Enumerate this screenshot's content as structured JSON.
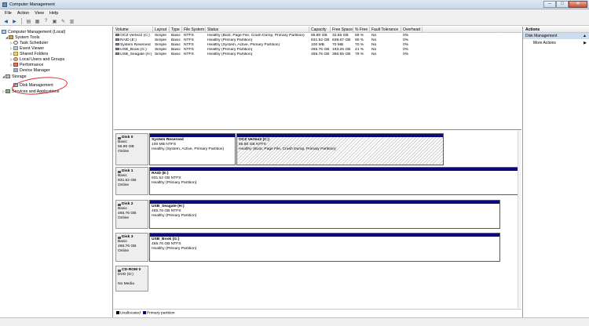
{
  "window": {
    "title": "Computer Management",
    "buttons": {
      "minimize": "─",
      "maximize": "□",
      "close": "✕"
    }
  },
  "menu": [
    "File",
    "Action",
    "View",
    "Help"
  ],
  "toolbar": [
    "back-icon",
    "forward-icon",
    "up-icon",
    "properties-icon",
    "help-icon",
    "refresh-icon",
    "settings-icon",
    "view-icon"
  ],
  "tree": {
    "root": "Computer Management (Local)",
    "system_tools": "System Tools",
    "task_scheduler": "Task Scheduler",
    "event_viewer": "Event Viewer",
    "shared_folders": "Shared Folders",
    "local_users": "Local Users and Groups",
    "performance": "Performance",
    "device_manager": "Device Manager",
    "storage": "Storage",
    "disk_management": "Disk Management",
    "services": "Services and Applications"
  },
  "volume_table": {
    "columns": [
      "Volume",
      "Layout",
      "Type",
      "File System",
      "Status",
      "Capacity",
      "Free Space",
      "% Free",
      "Fault Tolerance",
      "Overhead"
    ],
    "rows": [
      [
        "OCZ Vertex2 (C:)",
        "Simple",
        "Basic",
        "NTFS",
        "Healthy (Boot, Page File, Crash Dump, Primary Partition)",
        "55.80 GB",
        "32.65 GB",
        "59 %",
        "No",
        "0%"
      ],
      [
        "RAID (E:)",
        "Simple",
        "Basic",
        "NTFS",
        "Healthy (Primary Partition)",
        "931.52 GB",
        "839.67 GB",
        "90 %",
        "No",
        "0%"
      ],
      [
        "System Reserved",
        "Simple",
        "Basic",
        "NTFS",
        "Healthy (System, Active, Primary Partition)",
        "100 MB",
        "70 MB",
        "70 %",
        "No",
        "0%"
      ],
      [
        "USB_Book (G:)",
        "Simple",
        "Basic",
        "NTFS",
        "Healthy (Primary Partition)",
        "465.76 GB",
        "193.26 GB",
        "41 %",
        "No",
        "0%"
      ],
      [
        "USB_Seagate (H:)",
        "Simple",
        "Basic",
        "NTFS",
        "Healthy (Primary Partition)",
        "465.76 GB",
        "366.55 GB",
        "79 %",
        "No",
        "0%"
      ]
    ]
  },
  "disks": [
    {
      "name": "Disk 0",
      "type": "Basic",
      "size": "55.90 GB",
      "status": "Online",
      "partitions": [
        {
          "name": "System Reserved",
          "size": "100 MB NTFS",
          "status": "Healthy (System, Active, Primary Partition)"
        },
        {
          "name": "OCZ Vertex2 (C:)",
          "size": "55.80 GB NTFS",
          "status": "Healthy (Boot, Page File, Crash Dump, Primary Partition)"
        }
      ]
    },
    {
      "name": "Disk 1",
      "type": "Basic",
      "size": "931.52 GB",
      "status": "Online",
      "partitions": [
        {
          "name": "RAID (E:)",
          "size": "931.52 GB NTFS",
          "status": "Healthy (Primary Partition)"
        }
      ]
    },
    {
      "name": "Disk 2",
      "type": "Basic",
      "size": "465.76 GB",
      "status": "Online",
      "partitions": [
        {
          "name": "USB_Seagate (H:)",
          "size": "465.76 GB NTFS",
          "status": "Healthy (Primary Partition)"
        }
      ]
    },
    {
      "name": "Disk 3",
      "type": "Basic",
      "size": "465.76 GB",
      "status": "Online",
      "partitions": [
        {
          "name": "USB_Book (G:)",
          "size": "465.76 GB NTFS",
          "status": "Healthy (Primary Partition)"
        }
      ]
    },
    {
      "name": "CD-ROM 0",
      "type": "DVD (D:)",
      "size": "",
      "status": "No Media",
      "partitions": []
    }
  ],
  "legend": {
    "unallocated": "Unallocated",
    "primary": "Primary partition",
    "unallocated_color": "#000000",
    "primary_color": "#0a0a80"
  },
  "actions": {
    "header": "Actions",
    "section": "Disk Management",
    "more": "More Actions"
  }
}
